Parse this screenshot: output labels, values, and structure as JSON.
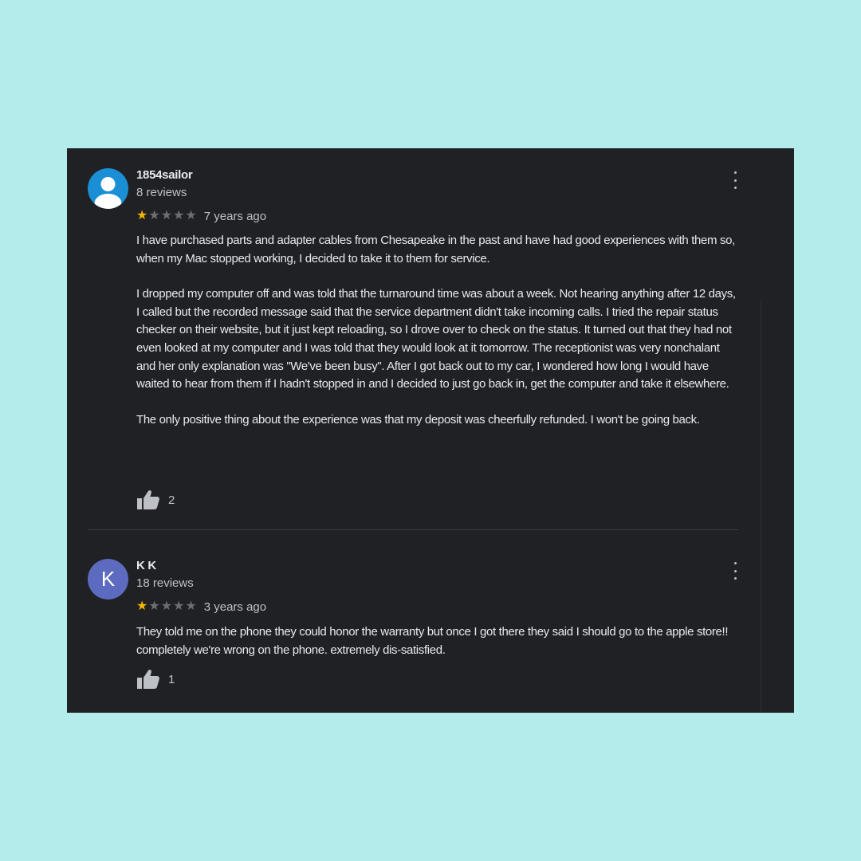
{
  "reviews": [
    {
      "author": "1854sailor",
      "review_count": "8 reviews",
      "avatar": "person-icon",
      "rating": 1,
      "max_rating": 5,
      "date": "7 years ago",
      "paragraphs": [
        "I have purchased parts and adapter cables from Chesapeake in the past and have had good experiences with them so, when my Mac stopped working, I decided to take it to them for service.",
        "I dropped my computer off and was told that the turnaround time was about a week. Not hearing anything after 12 days, I called but the recorded message said that the service department didn't take incoming calls. I tried the repair status checker on their website, but it just kept reloading, so I drove over to check on the status. It turned out that they had not even looked at my computer and I was told that they would look at it tomorrow. The receptionist was very nonchalant and her only explanation was \"We've been busy\". After I got back out to my car, I wondered how long I would have waited to hear from them if I hadn't stopped in and I decided to just go back in, get the computer and take it elsewhere.",
        "The only positive thing about the experience was that my deposit was cheerfully refunded. I won't be going back."
      ],
      "likes": "2"
    },
    {
      "author": "K K",
      "review_count": "18 reviews",
      "avatar_letter": "K",
      "rating": 1,
      "max_rating": 5,
      "date": "3 years ago",
      "paragraphs": [
        "They told me on the phone they could honor the warranty but once I got there they said I should go to the apple store!! completely we're wrong on the phone. extremely dis-satisfied."
      ],
      "likes": "1"
    }
  ],
  "colors": {
    "background": "#b4ebeb",
    "panel": "#202124",
    "star_filled": "#f5b400",
    "star_empty": "#6c6e72",
    "avatar_default": "#1a8fd6",
    "avatar_letter": "#5c6bc0"
  }
}
